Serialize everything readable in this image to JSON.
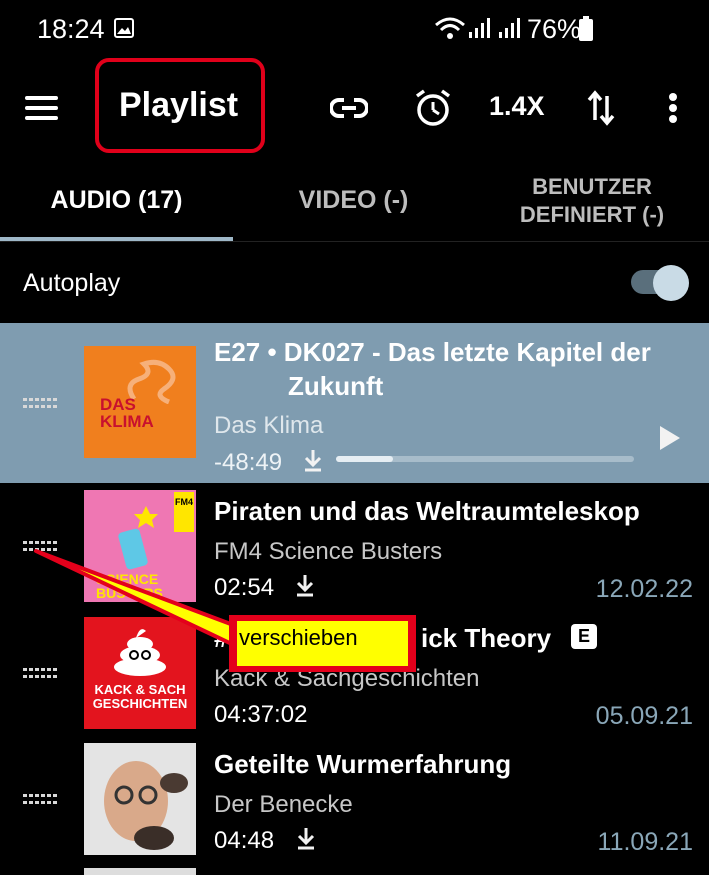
{
  "status_bar": {
    "time": "18:24",
    "battery_percent": "76%"
  },
  "toolbar": {
    "title": "Playlist",
    "speed": "1.4X"
  },
  "tabs": [
    {
      "label": "AUDIO (17)",
      "active": true
    },
    {
      "label": "VIDEO (-)",
      "active": false
    },
    {
      "label_line1": "BENUTZER",
      "label_line2": "DEFINIERT (-)",
      "active": false
    }
  ],
  "autoplay": {
    "label": "Autoplay",
    "enabled": true
  },
  "episodes": [
    {
      "title_line1": "E27 • DK027 - Das letzte Kapitel der",
      "title_line2": "Zukunft",
      "podcast": "Das Klima",
      "duration": "-48:49",
      "progress": 0.19,
      "current": true,
      "thumb_text1": "DAS",
      "thumb_text2": "KLIMA"
    },
    {
      "title": "Piraten und das Weltraumteleskop",
      "podcast": "FM4 Science Busters",
      "duration": "02:54",
      "date": "12.02.22",
      "thumb_text1": "SCIENCE",
      "thumb_text2": "BUSTERS",
      "thumb_badge": "FM4"
    },
    {
      "title_prefix": "#",
      "title_suffix": "ick Theory",
      "explicit": "E",
      "podcast": "Kack & Sachgeschichten",
      "duration": "04:37:02",
      "date": "05.09.21",
      "thumb_text1": "KACK & SACH",
      "thumb_text2": "GESCHICHTEN"
    },
    {
      "title": "Geteilte Wurmerfahrung",
      "podcast": "Der Benecke",
      "duration": "04:48",
      "date": "11.09.21"
    }
  ],
  "annotation": {
    "label": "verschieben"
  },
  "colors": {
    "highlight_row": "#7f9cb0",
    "accent": "#9fb8c8",
    "annotation_red": "#e4001b",
    "annotation_yellow": "#ffff00"
  }
}
